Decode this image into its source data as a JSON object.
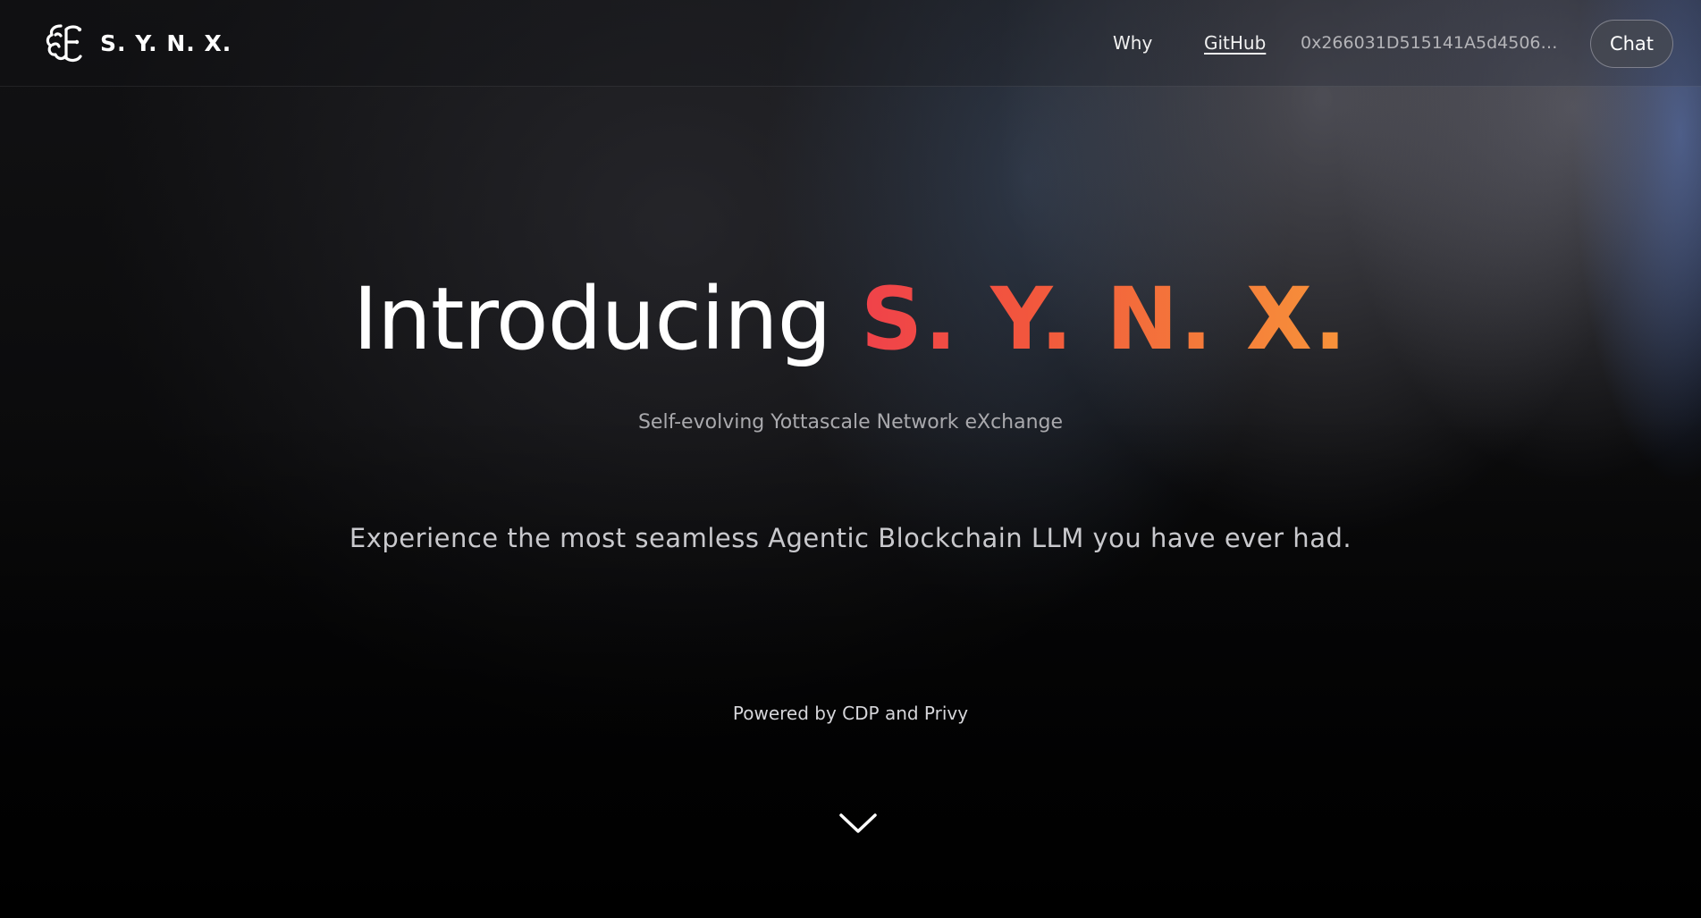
{
  "header": {
    "brand_name": "S. Y. N. X.",
    "logo_icon": "brain-icon",
    "nav": {
      "why_label": "Why",
      "github_label": "GitHub"
    },
    "wallet_address": "0x266031D515141A5d4506c1...",
    "chat_label": "Chat"
  },
  "hero": {
    "title_prefix": "Introducing",
    "title_brand": "S. Y. N. X.",
    "subtitle": "Self-evolving Yottascale Network eXchange",
    "tagline": "Experience the most seamless Agentic Blockchain LLM you have ever had.",
    "powered_by": "Powered by CDP and Privy",
    "scroll_icon": "chevron-down-icon"
  },
  "colors": {
    "background": "#000000",
    "brand_gradient_start": "#f0424a",
    "brand_gradient_end": "#f8933a",
    "text_primary": "#ffffff",
    "text_muted": "#a9a9ad"
  }
}
